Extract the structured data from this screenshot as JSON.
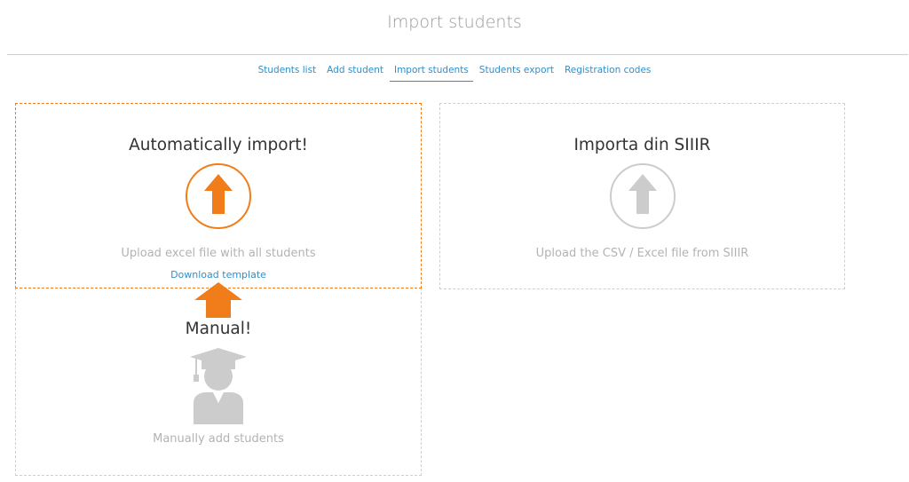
{
  "page": {
    "title": "Import students"
  },
  "tabs": [
    {
      "label": "Students list",
      "active": false
    },
    {
      "label": "Add student",
      "active": false
    },
    {
      "label": "Import students",
      "active": true
    },
    {
      "label": "Students export",
      "active": false
    },
    {
      "label": "Registration codes",
      "active": false
    }
  ],
  "cards": {
    "auto_import": {
      "title": "Automatically import!",
      "description": "Upload excel file with all students",
      "link": "Download template",
      "icon": "upload-arrow-icon",
      "color": "#f07d1a"
    },
    "siiir_import": {
      "title": "Importa din SIIIR",
      "description": "Upload the CSV / Excel file from SIIIR",
      "icon": "upload-arrow-icon",
      "color": "#cccccc"
    },
    "manual": {
      "title": "Manual!",
      "description": "Manually add students",
      "icon": "graduate-student-icon",
      "color": "#cccccc"
    }
  },
  "colors": {
    "accent": "#f07d1a",
    "link": "#2f8fca",
    "muted": "#b3b3b3"
  }
}
